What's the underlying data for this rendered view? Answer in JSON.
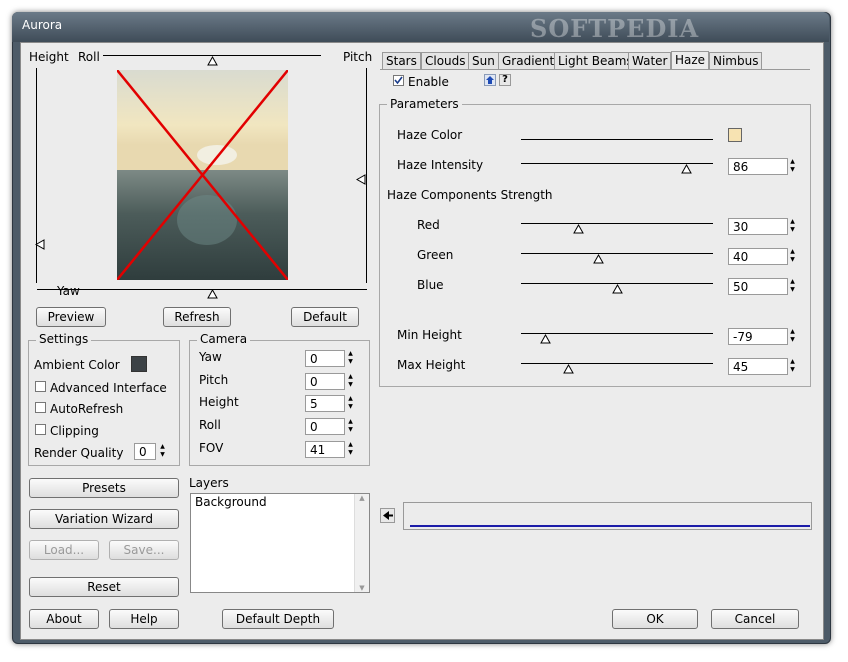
{
  "window": {
    "title": "Aurora",
    "watermark": "SOFTPEDIA"
  },
  "preview": {
    "height_label": "Height",
    "roll_label": "Roll",
    "pitch_label": "Pitch",
    "yaw_label": "Yaw",
    "buttons": {
      "preview": "Preview",
      "refresh": "Refresh",
      "default": "Default"
    }
  },
  "tabs": [
    "Stars",
    "Clouds",
    "Sun",
    "Gradient",
    "Light Beams",
    "Water",
    "Haze",
    "Nimbus"
  ],
  "active_tab": "Haze",
  "enable_label": "Enable",
  "parameters": {
    "title": "Parameters",
    "haze_color_label": "Haze Color",
    "haze_color_value": "#f7e3b2",
    "haze_intensity_label": "Haze Intensity",
    "haze_intensity": "86",
    "components_label": "Haze Components Strength",
    "red_label": "Red",
    "red": "30",
    "green_label": "Green",
    "green": "40",
    "blue_label": "Blue",
    "blue": "50",
    "min_height_label": "Min Height",
    "min_height": "-79",
    "max_height_label": "Max Height",
    "max_height": "45"
  },
  "settings": {
    "title": "Settings",
    "ambient_label": "Ambient Color",
    "ambient_value": "#3c4246",
    "advanced_label": "Advanced Interface",
    "autorefresh_label": "AutoRefresh",
    "clipping_label": "Clipping",
    "render_quality_label": "Render Quality",
    "render_quality": "0"
  },
  "camera": {
    "title": "Camera",
    "yaw_label": "Yaw",
    "yaw": "0",
    "pitch_label": "Pitch",
    "pitch": "0",
    "height_label": "Height",
    "height": "5",
    "roll_label": "Roll",
    "roll": "0",
    "fov_label": "FOV",
    "fov": "41"
  },
  "buttons": {
    "presets": "Presets",
    "variation_wizard": "Variation Wizard",
    "load": "Load...",
    "save": "Save...",
    "reset": "Reset",
    "about": "About",
    "help": "Help",
    "default_depth": "Default Depth",
    "ok": "OK",
    "cancel": "Cancel"
  },
  "layers": {
    "title": "Layers",
    "items": [
      "Background"
    ]
  }
}
